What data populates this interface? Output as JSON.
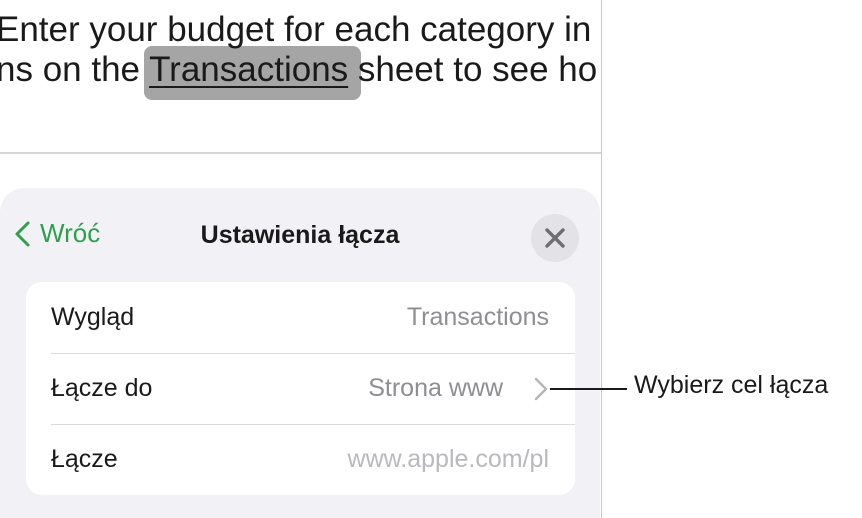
{
  "document": {
    "line1": "Enter your budget for each category in",
    "line2_prefix": "ns on the ",
    "line2_link": "Transactions",
    "line2_suffix": " sheet to see ho"
  },
  "sheet": {
    "back_label": "Wróć",
    "title": "Ustawienia łącza",
    "rows": [
      {
        "label": "Wygląd",
        "value": "Transactions"
      },
      {
        "label": "Łącze do",
        "value": "Strona www"
      },
      {
        "label": "Łącze",
        "value": "www.apple.com/pl"
      }
    ]
  },
  "callout": {
    "text": "Wybierz cel łącza"
  },
  "colors": {
    "accent": "#2f9f4f",
    "sheet_bg": "#f2f2f6",
    "highlight": "#a5a5a5"
  },
  "icons": {
    "back": "chevron-left-icon",
    "close": "close-icon",
    "disclosure": "chevron-right-icon"
  }
}
